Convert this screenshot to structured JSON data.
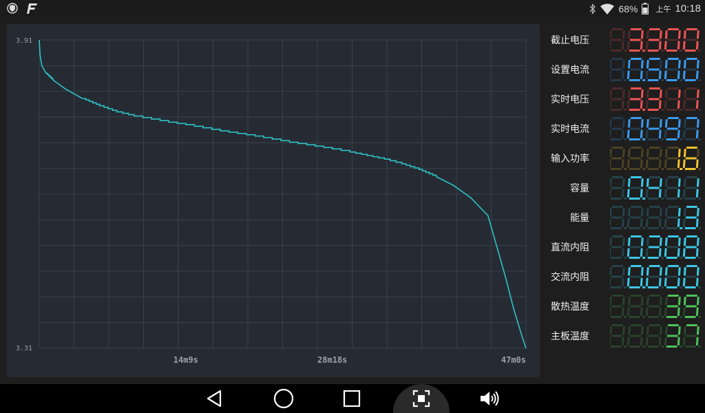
{
  "status_bar": {
    "battery": "68%",
    "ampm": "上午",
    "time": "10:18"
  },
  "chart_data": {
    "type": "line",
    "y_max_label": "3.91",
    "y_min_label": "3.31",
    "ylim": [
      3.31,
      3.91
    ],
    "x_ticks": [
      "14m9s",
      "28m18s",
      "47m0s"
    ],
    "xlim_seconds": [
      0,
      2820
    ],
    "x_tick_seconds": [
      849,
      1698,
      2820
    ],
    "grid": true,
    "line_color": "#2ec4c9",
    "series": [
      {
        "x": [
          0,
          5,
          15,
          40,
          80,
          150,
          250,
          350,
          450,
          550,
          650,
          750,
          849,
          950,
          1050,
          1150,
          1250,
          1350,
          1450,
          1550,
          1698,
          1800,
          1900,
          2000,
          2100,
          2200,
          2300,
          2400,
          2500,
          2600,
          2700,
          2750,
          2800,
          2820
        ],
        "y": [
          3.91,
          3.88,
          3.86,
          3.845,
          3.832,
          3.815,
          3.796,
          3.782,
          3.77,
          3.762,
          3.756,
          3.75,
          3.745,
          3.739,
          3.733,
          3.728,
          3.723,
          3.717,
          3.711,
          3.706,
          3.698,
          3.692,
          3.685,
          3.678,
          3.669,
          3.658,
          3.644,
          3.627,
          3.603,
          3.568,
          3.45,
          3.385,
          3.33,
          3.31
        ]
      }
    ]
  },
  "readings": [
    {
      "label": "截止电压",
      "value": "3.300",
      "digits": 5,
      "color": "#f25454"
    },
    {
      "label": "设置电流",
      "value": "0.500",
      "digits": 5,
      "color": "#3a9cf2"
    },
    {
      "label": "实时电压",
      "value": "3.311",
      "digits": 5,
      "color": "#f25454"
    },
    {
      "label": "实时电流",
      "value": "0.497",
      "digits": 5,
      "color": "#3a9cf2"
    },
    {
      "label": "输入功率",
      "value": "1.6",
      "digits": 5,
      "color": "#f2c230"
    },
    {
      "label": "容量",
      "value": "0.411",
      "digits": 5,
      "color": "#3cc8e8"
    },
    {
      "label": "能量",
      "value": "1.3",
      "digits": 5,
      "color": "#3cc8e8"
    },
    {
      "label": "直流内阻",
      "value": "0.308",
      "digits": 5,
      "color": "#3cc8e8"
    },
    {
      "label": "交流内阻",
      "value": "0.000",
      "digits": 5,
      "color": "#3cc8e8"
    },
    {
      "label": "散热温度",
      "value": "39",
      "digits": 5,
      "color": "#4ec45a"
    },
    {
      "label": "主板温度",
      "value": "37",
      "digits": 5,
      "color": "#4ec45a"
    }
  ],
  "nav": {
    "icons": [
      "back-icon",
      "home-icon",
      "recents-icon",
      "screenshot-icon",
      "volume-icon"
    ]
  }
}
